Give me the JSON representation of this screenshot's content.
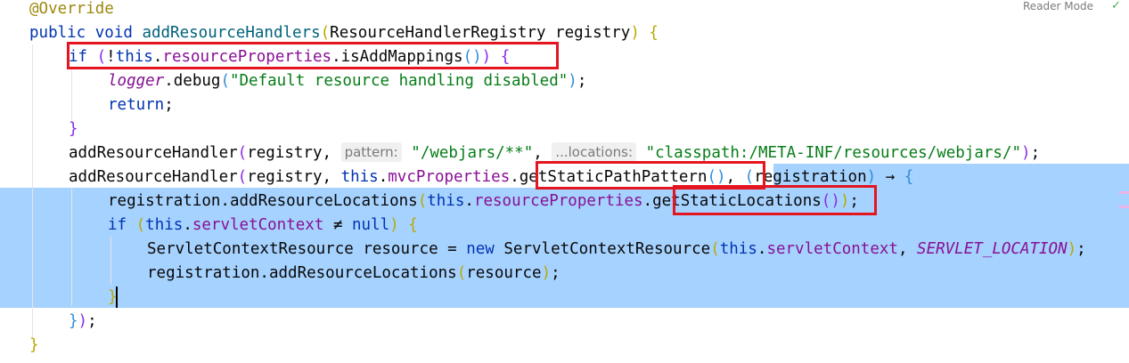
{
  "editor": {
    "reader_mode_label": "Reader Mode",
    "inspection_icon": "check-mark",
    "lines": [
      {
        "parts": [
          {
            "t": "@Override",
            "c": "ann"
          }
        ]
      },
      {
        "parts": [
          {
            "t": "public void ",
            "c": "kw"
          },
          {
            "t": "addResourceHandlers",
            "c": "fn"
          },
          {
            "t": "(",
            "c": "p1"
          },
          {
            "t": "ResourceHandlerRegistry registry",
            "c": ""
          },
          {
            "t": ")",
            "c": "p1"
          },
          {
            "t": " {",
            "c": "p1"
          }
        ]
      },
      {
        "parts": [
          {
            "t": "if ",
            "c": "kw"
          },
          {
            "t": "(",
            "c": "p2"
          },
          {
            "t": "!",
            "c": ""
          },
          {
            "t": "this",
            "c": "kw"
          },
          {
            "t": ".",
            "c": ""
          },
          {
            "t": "resourceProperties",
            "c": "fld"
          },
          {
            "t": ".isAddMappings",
            "c": ""
          },
          {
            "t": "()",
            "c": "p3"
          },
          {
            "t": ")",
            "c": "p2"
          },
          {
            "t": " {",
            "c": "p2"
          }
        ]
      },
      {
        "parts": [
          {
            "t": "logger",
            "c": "logger"
          },
          {
            "t": ".debug",
            "c": ""
          },
          {
            "t": "(",
            "c": "p3"
          },
          {
            "t": "\"Default resource handling disabled\"",
            "c": "str"
          },
          {
            "t": ")",
            "c": "p3"
          },
          {
            "t": ";",
            "c": ""
          }
        ]
      },
      {
        "parts": [
          {
            "t": "return",
            "c": "kw"
          },
          {
            "t": ";",
            "c": ""
          }
        ]
      },
      {
        "parts": [
          {
            "t": "}",
            "c": "p2"
          }
        ]
      },
      {
        "parts": [
          {
            "t": "addResourceHandler",
            "c": ""
          },
          {
            "t": "(",
            "c": "p2"
          },
          {
            "t": "registry, ",
            "c": ""
          },
          {
            "t": "pattern:",
            "c": "hint"
          },
          {
            "t": " ",
            "c": ""
          },
          {
            "t": "\"/webjars/**\"",
            "c": "str"
          },
          {
            "t": ", ",
            "c": ""
          },
          {
            "t": "...locations:",
            "c": "hint"
          },
          {
            "t": " ",
            "c": ""
          },
          {
            "t": "\"classpath:/META-INF/resources/webjars/\"",
            "c": "str"
          },
          {
            "t": ")",
            "c": "p2"
          },
          {
            "t": ";",
            "c": ""
          }
        ]
      },
      {
        "parts": [
          {
            "t": "addResourceHandler",
            "c": ""
          },
          {
            "t": "(",
            "c": "p2"
          },
          {
            "t": "registry, ",
            "c": ""
          },
          {
            "t": "this",
            "c": "kw"
          },
          {
            "t": ".",
            "c": ""
          },
          {
            "t": "mvcProperties",
            "c": "fld"
          },
          {
            "t": ".getStaticPathPattern",
            "c": ""
          },
          {
            "t": "()",
            "c": "p3"
          },
          {
            "t": ", ",
            "c": ""
          },
          {
            "t": "(",
            "c": "p3"
          },
          {
            "t": "registration",
            "c": ""
          },
          {
            "t": ")",
            "c": "p3"
          },
          {
            "t": " → ",
            "c": ""
          },
          {
            "t": "{",
            "c": "p3"
          }
        ]
      },
      {
        "parts": [
          {
            "t": "registration.addResourceLocations",
            "c": ""
          },
          {
            "t": "(",
            "c": "p1"
          },
          {
            "t": "this",
            "c": "kw"
          },
          {
            "t": ".",
            "c": ""
          },
          {
            "t": "resourceProperties",
            "c": "fld"
          },
          {
            "t": ".getStaticLocations",
            "c": ""
          },
          {
            "t": "()",
            "c": "p2"
          },
          {
            "t": ")",
            "c": "p1"
          },
          {
            "t": ";",
            "c": ""
          }
        ]
      },
      {
        "parts": [
          {
            "t": "if ",
            "c": "kw"
          },
          {
            "t": "(",
            "c": "p1"
          },
          {
            "t": "this",
            "c": "kw"
          },
          {
            "t": ".",
            "c": ""
          },
          {
            "t": "servletContext",
            "c": "fld"
          },
          {
            "t": " ≠ ",
            "c": ""
          },
          {
            "t": "null",
            "c": "kw"
          },
          {
            "t": ")",
            "c": "p1"
          },
          {
            "t": " {",
            "c": "p1"
          }
        ]
      },
      {
        "parts": [
          {
            "t": "ServletContextResource resource = ",
            "c": ""
          },
          {
            "t": "new ",
            "c": "kw"
          },
          {
            "t": "ServletContextResource",
            "c": ""
          },
          {
            "t": "(",
            "c": "p1"
          },
          {
            "t": "this",
            "c": "kw"
          },
          {
            "t": ".",
            "c": ""
          },
          {
            "t": "servletContext",
            "c": "fld"
          },
          {
            "t": ", ",
            "c": ""
          },
          {
            "t": "SERVLET_LOCATION",
            "c": "const"
          },
          {
            "t": ")",
            "c": "p1"
          },
          {
            "t": ";",
            "c": ""
          }
        ]
      },
      {
        "parts": [
          {
            "t": "registration.addResourceLocations",
            "c": ""
          },
          {
            "t": "(",
            "c": "p1"
          },
          {
            "t": "resource",
            "c": ""
          },
          {
            "t": ")",
            "c": "p1"
          },
          {
            "t": ";",
            "c": ""
          }
        ]
      },
      {
        "parts": [
          {
            "t": "}",
            "c": "p1"
          }
        ]
      },
      {
        "parts": [
          {
            "t": "}",
            "c": "p3"
          },
          {
            "t": ")",
            "c": "p2"
          },
          {
            "t": ";",
            "c": ""
          }
        ]
      },
      {
        "parts": [
          {
            "t": "}",
            "c": "p1"
          }
        ]
      }
    ]
  }
}
